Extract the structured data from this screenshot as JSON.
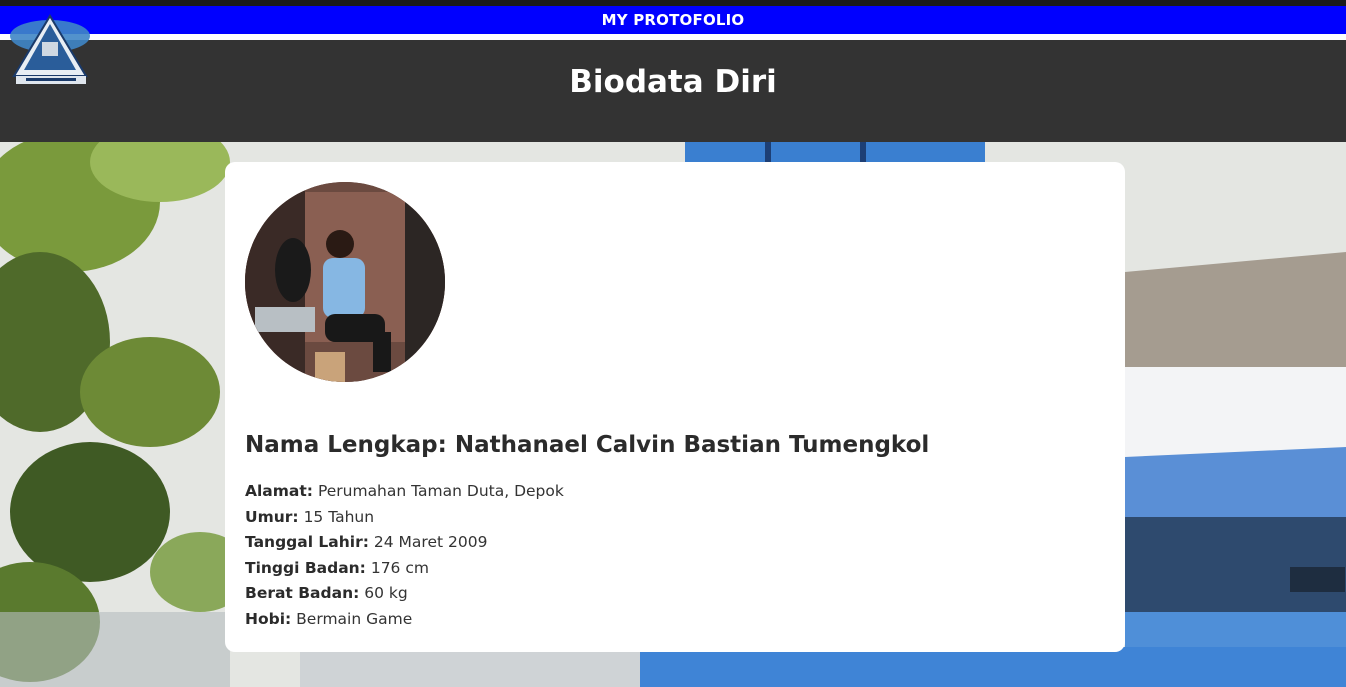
{
  "topbar": {
    "title": "MY PROTOFOLIO"
  },
  "header": {
    "title": "Biodata Diri"
  },
  "profile": {
    "name_label": "Nama Lengkap:",
    "name_value": "Nathanael Calvin Bastian Tumengkol",
    "fields": [
      {
        "label": "Alamat:",
        "value": "Perumahan Taman Duta, Depok"
      },
      {
        "label": "Umur:",
        "value": "15 Tahun"
      },
      {
        "label": "Tanggal Lahir:",
        "value": "24 Maret 2009"
      },
      {
        "label": "Tinggi Badan:",
        "value": "176 cm"
      },
      {
        "label": "Berat Badan:",
        "value": "60 kg"
      },
      {
        "label": "Hobi:",
        "value": "Bermain Game"
      }
    ]
  },
  "colors": {
    "topbar_bg": "#0000ff",
    "header_bg": "#333333",
    "card_bg": "#ffffff",
    "text_dark": "#2b2b2b"
  },
  "icons": {
    "logo": "school-logo-icon"
  }
}
